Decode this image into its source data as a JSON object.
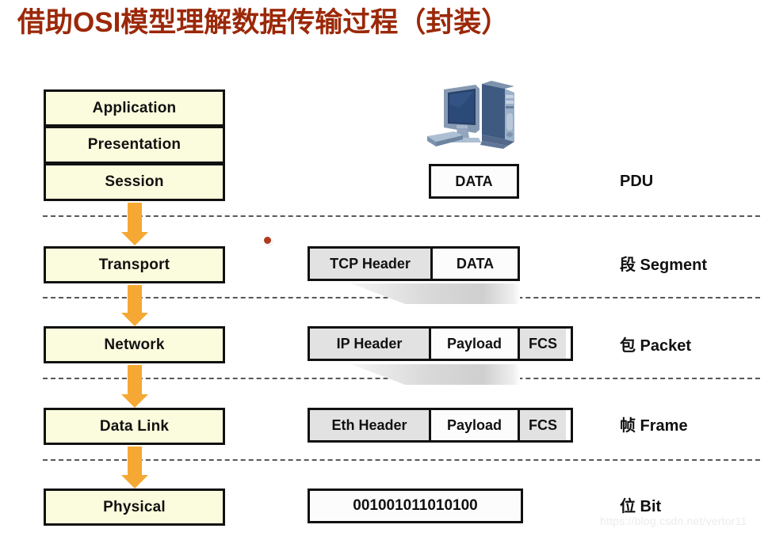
{
  "title": "借助OSI模型理解数据传输过程（封装）",
  "title_color": "#9B2808",
  "accent_color": "#F5A833",
  "layer_box_fill": "#FBFBDD",
  "layers": [
    {
      "label": "Application"
    },
    {
      "label": "Presentation"
    },
    {
      "label": "Session"
    },
    {
      "label": "Transport"
    },
    {
      "label": "Network"
    },
    {
      "label": "Data Link"
    },
    {
      "label": "Physical"
    }
  ],
  "pdu_labels": [
    {
      "label": "PDU"
    },
    {
      "label": "段 Segment"
    },
    {
      "label": "包 Packet"
    },
    {
      "label": "帧 Frame"
    },
    {
      "label": "位 Bit"
    }
  ],
  "pdu_rows": {
    "application": {
      "cells": [
        {
          "text": "DATA",
          "fill": "white"
        }
      ]
    },
    "transport": {
      "cells": [
        {
          "text": "TCP Header",
          "fill": "gray"
        },
        {
          "text": "DATA",
          "fill": "white"
        }
      ]
    },
    "network": {
      "cells": [
        {
          "text": "IP Header",
          "fill": "gray"
        },
        {
          "text": "Payload",
          "fill": "white"
        },
        {
          "text": "FCS",
          "fill": "gray"
        }
      ]
    },
    "datalink": {
      "cells": [
        {
          "text": "Eth Header",
          "fill": "gray"
        },
        {
          "text": "Payload",
          "fill": "white"
        },
        {
          "text": "FCS",
          "fill": "gray"
        }
      ]
    },
    "physical": {
      "cells": [
        {
          "text": "001001011010100",
          "fill": "white"
        }
      ]
    }
  },
  "icons": {
    "computer": "desktop-computer-icon"
  },
  "watermark": "https://blog.csdn.net/vertor11"
}
